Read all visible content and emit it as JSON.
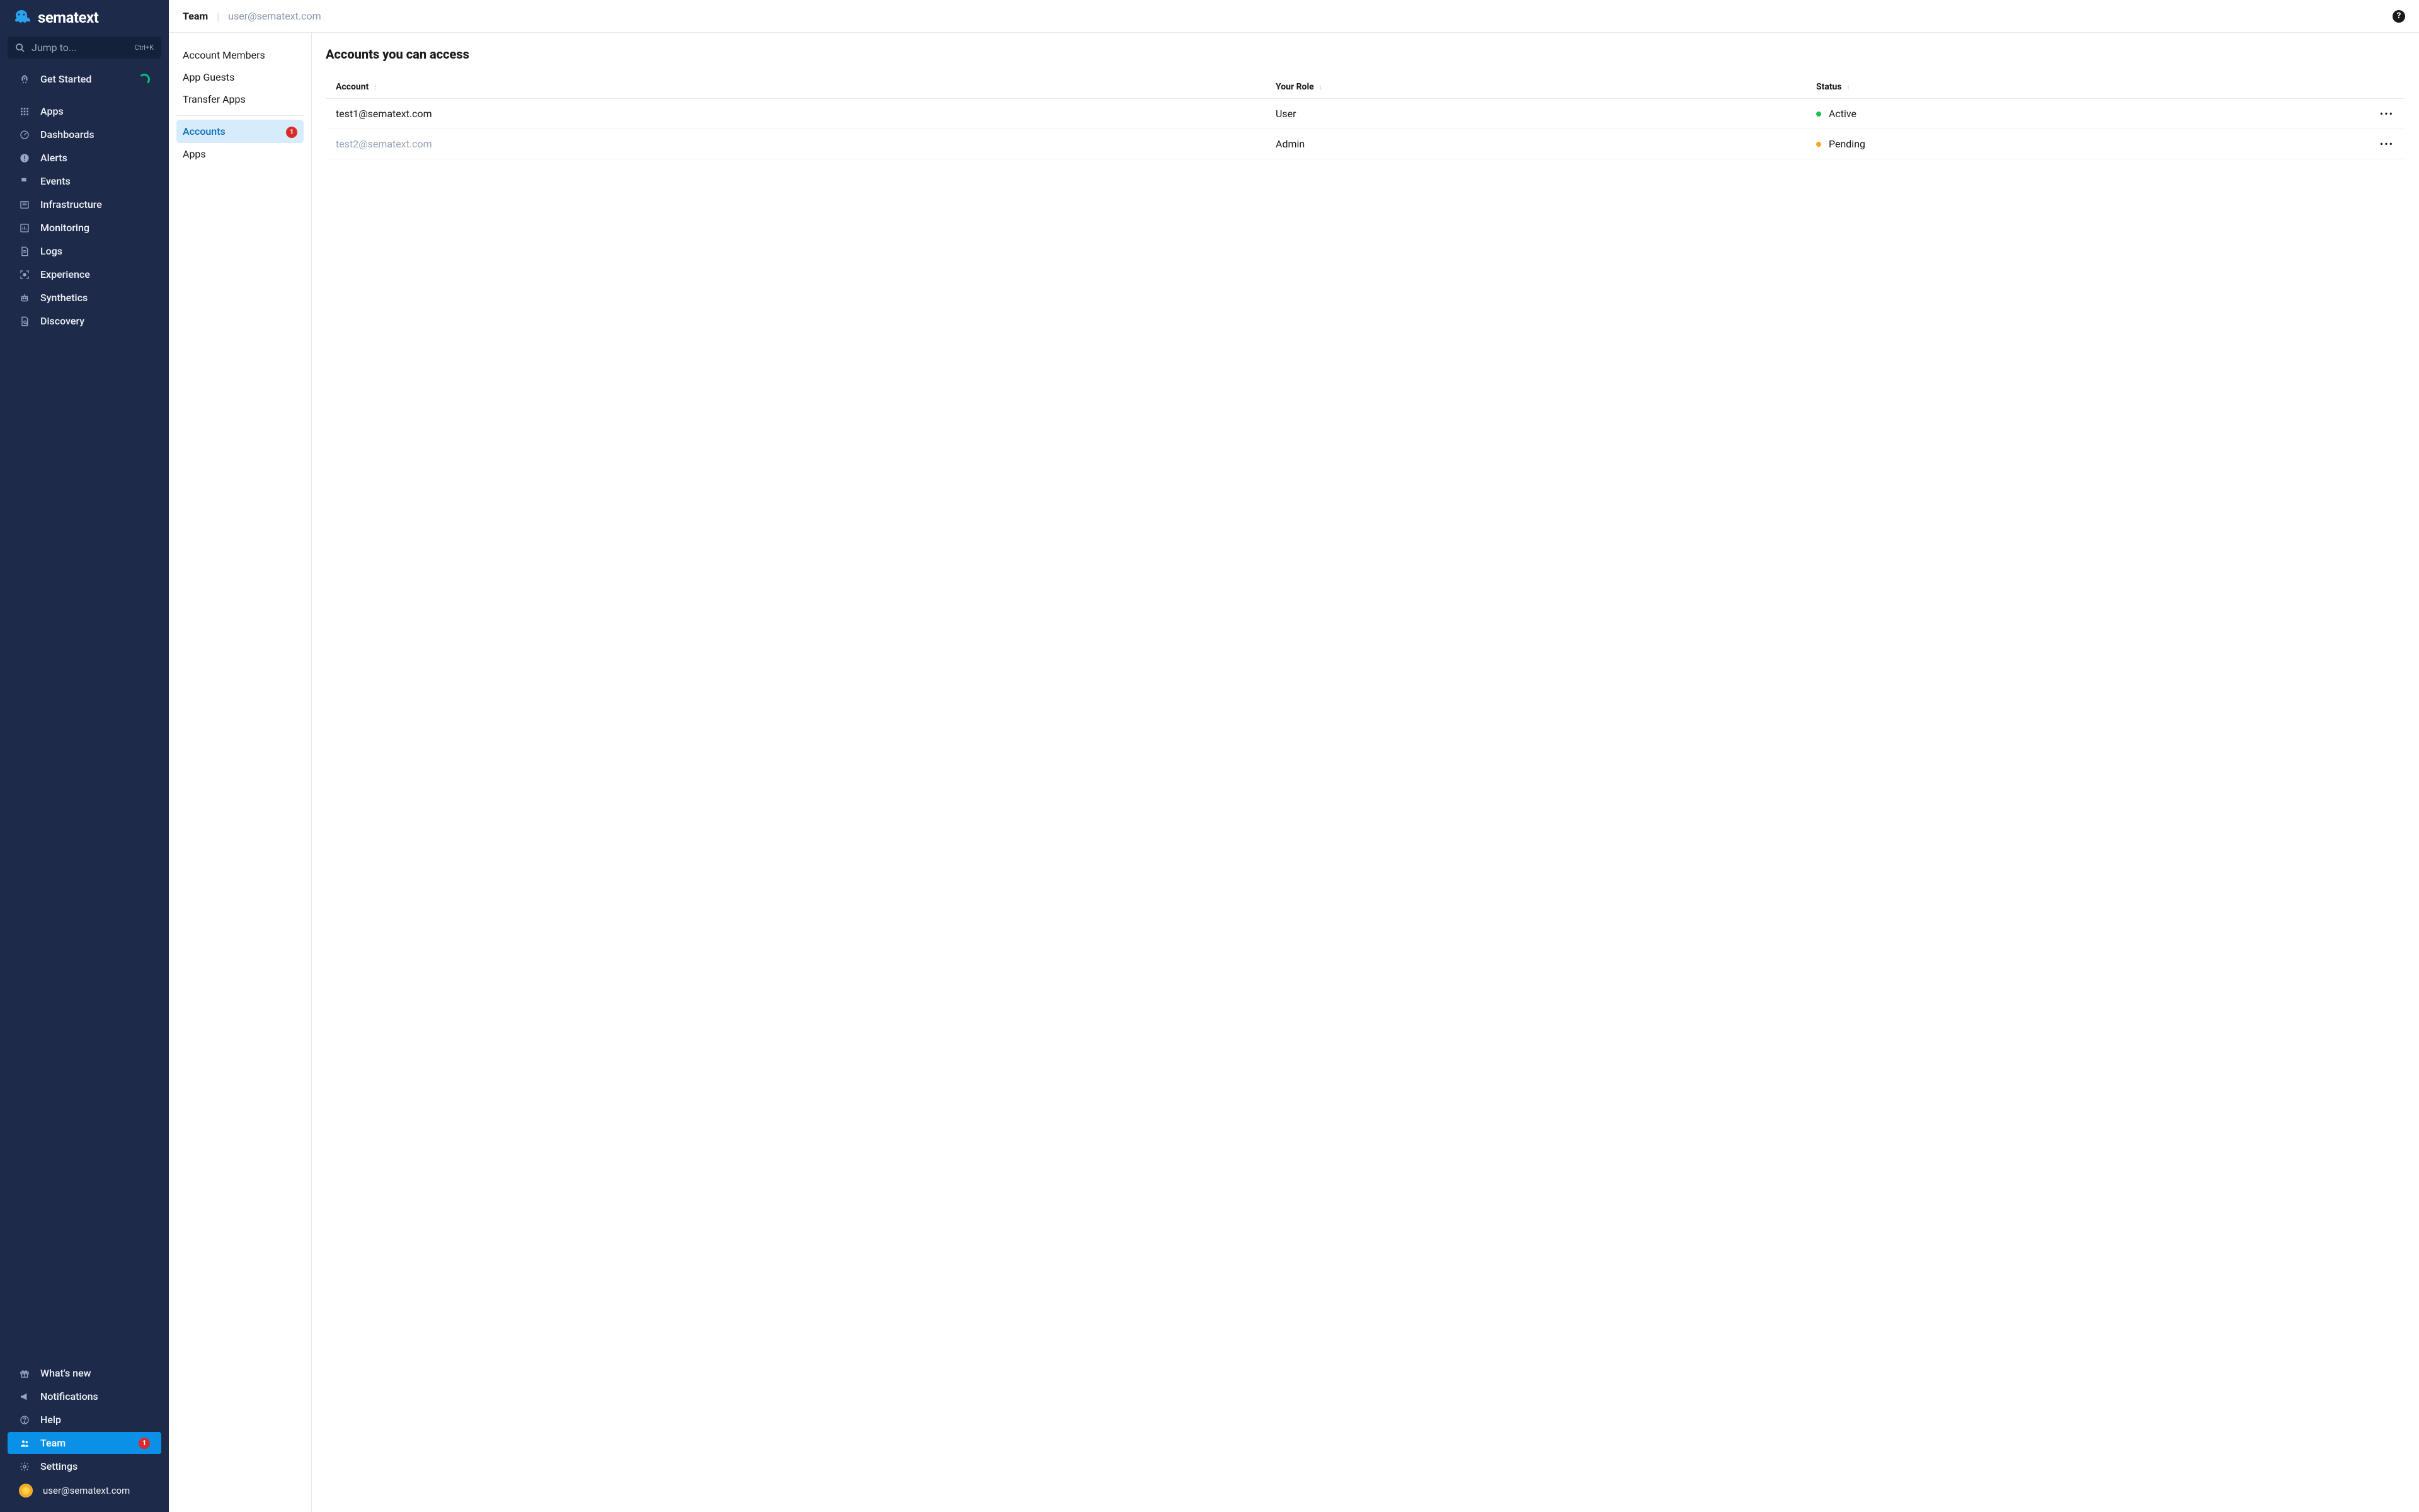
{
  "brand": {
    "name": "sematext"
  },
  "search": {
    "placeholder": "Jump to...",
    "shortcut": "Ctrl+K"
  },
  "sidebar": {
    "get_started": "Get Started",
    "main": [
      {
        "label": "Apps"
      },
      {
        "label": "Dashboards"
      },
      {
        "label": "Alerts"
      },
      {
        "label": "Events"
      },
      {
        "label": "Infrastructure"
      },
      {
        "label": "Monitoring"
      },
      {
        "label": "Logs"
      },
      {
        "label": "Experience"
      },
      {
        "label": "Synthetics"
      },
      {
        "label": "Discovery"
      }
    ],
    "footer": [
      {
        "label": "What's new"
      },
      {
        "label": "Notifications"
      },
      {
        "label": "Help"
      },
      {
        "label": "Team",
        "badge": "1",
        "active": true
      },
      {
        "label": "Settings"
      }
    ],
    "user_email": "user@sematext.com"
  },
  "breadcrumb": {
    "primary": "Team",
    "secondary": "user@sematext.com"
  },
  "help_glyph": "?",
  "subnav": {
    "top": [
      {
        "label": "Account Members"
      },
      {
        "label": "App Guests"
      },
      {
        "label": "Transfer Apps"
      }
    ],
    "bottom": [
      {
        "label": "Accounts",
        "badge": "1",
        "selected": true
      },
      {
        "label": "Apps"
      }
    ]
  },
  "content": {
    "heading": "Accounts you can access",
    "columns": {
      "account": "Account",
      "role": "Your Role",
      "status": "Status"
    },
    "sort_glyph_neutral": "↕",
    "sort_glyph_asc": "↑",
    "rows": [
      {
        "account": "test1@sematext.com",
        "role": "User",
        "status": "Active",
        "status_color": "green",
        "pending": false
      },
      {
        "account": "test2@sematext.com",
        "role": "Admin",
        "status": "Pending",
        "status_color": "orange",
        "pending": true
      }
    ],
    "row_action_glyph": "•••"
  }
}
